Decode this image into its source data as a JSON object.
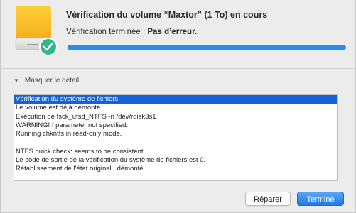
{
  "dialog": {
    "title": "Vérification du volume “Maxtor” (1 To) en cours",
    "status_prefix": "Vérification terminée : ",
    "status_result": "Pas d’erreur.",
    "progress_fraction": 1.0,
    "icon": "external-drive-icon",
    "badge_icon": "checkmark-badge-icon",
    "accent_color": "#2a8cf0"
  },
  "detail": {
    "toggle_label": "Masquer le détail",
    "toggle_icon": "disclosure-triangle-down-icon",
    "log_lines": [
      "Vérification du système de fichiers.",
      "Le volume est déjà démonté.",
      "Exécution de fsck_ufsd_NTFS -n /dev/rdisk3s1",
      "WARNING!  f parameter not specified.",
      "Running chkntfs in read-only mode.",
      "",
      "NTFS quick check: seems to be consistent",
      "Le code de sortie de la vérification du système de fichiers est 0.",
      "Rétablissement de l’état original : démonté."
    ],
    "selected_index": 0
  },
  "buttons": {
    "repair_label": "Réparer",
    "done_label": "Terminé"
  }
}
